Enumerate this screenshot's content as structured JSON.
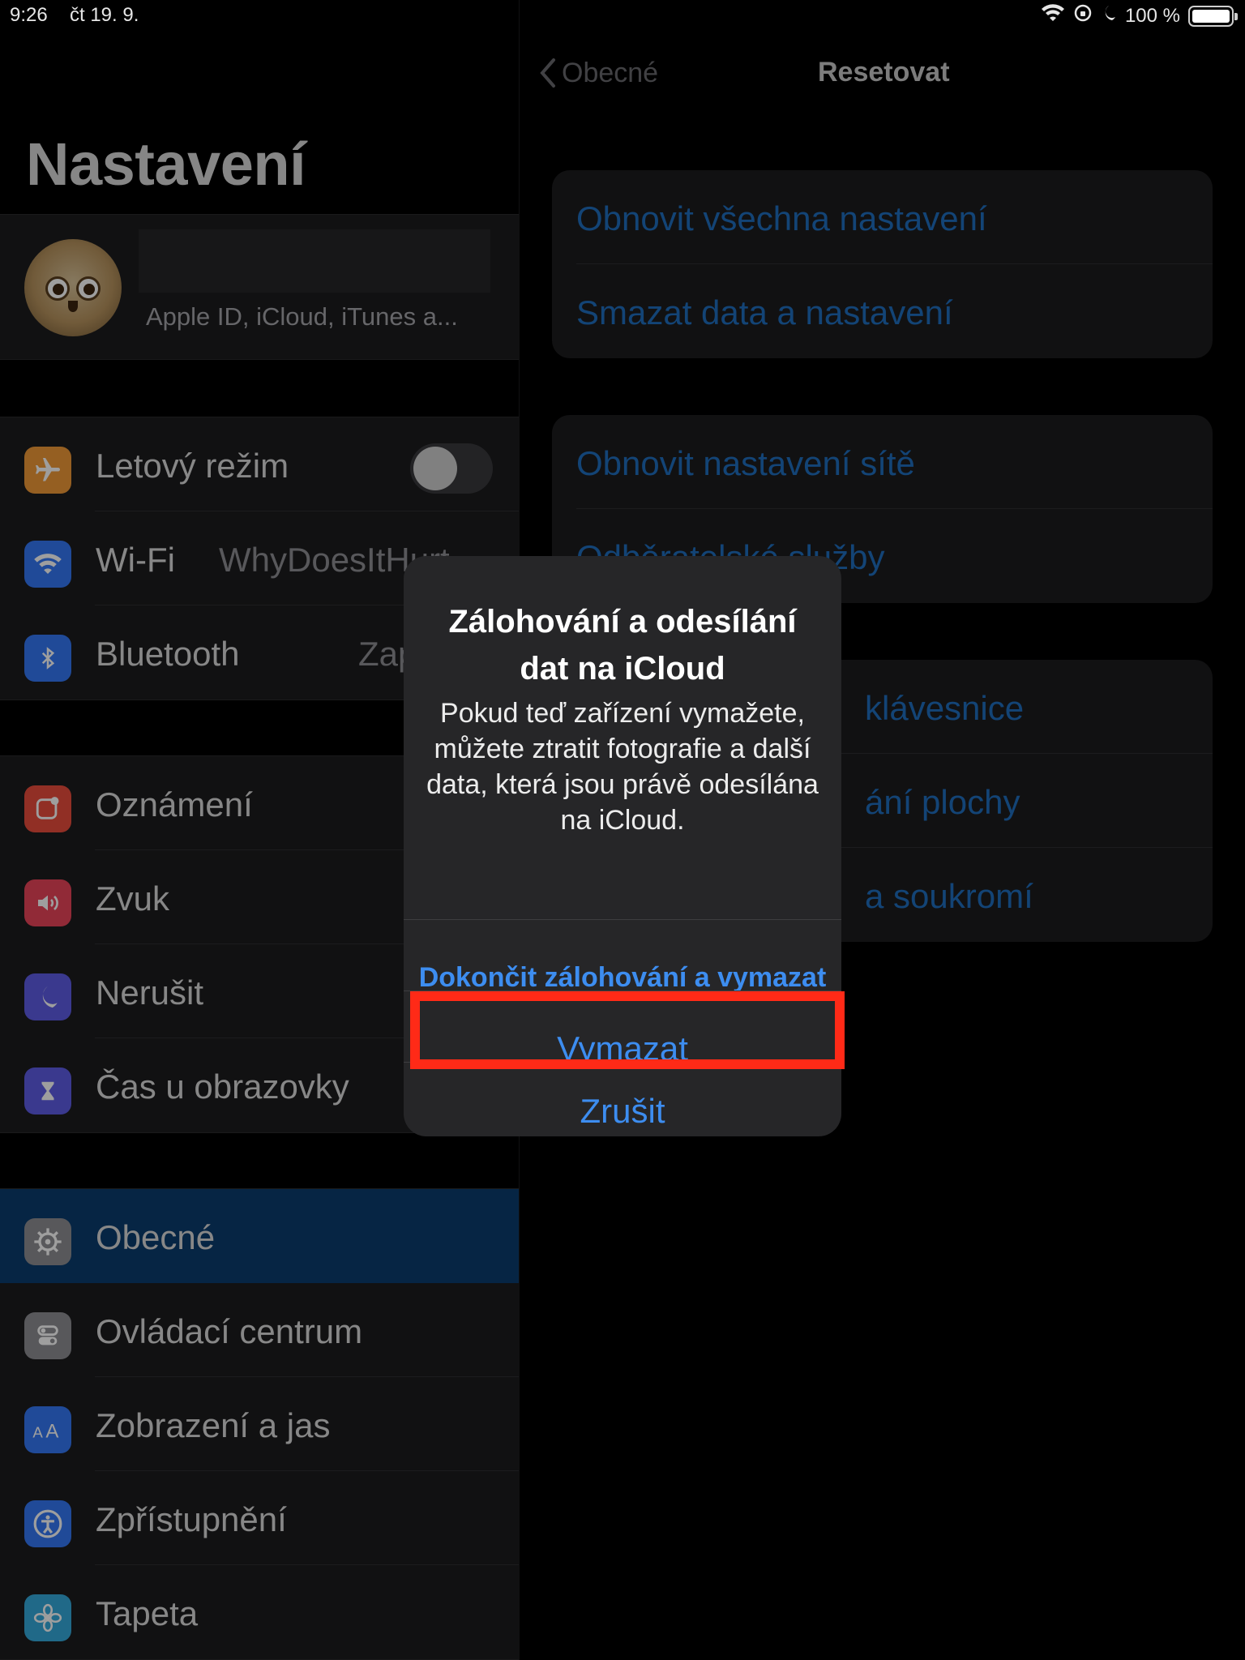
{
  "status_bar": {
    "time": "9:26",
    "date": "čt 19. 9.",
    "battery_text": "100 %"
  },
  "sidebar": {
    "title": "Nastavení",
    "profile": {
      "subtitle": "Apple ID, iCloud, iTunes a..."
    },
    "groups": [
      {
        "items": [
          {
            "label": "Letový režim",
            "icon": "airplane-icon",
            "color": "#f09a37",
            "control": "toggle-off"
          },
          {
            "label": "Wi-Fi",
            "icon": "wifi-icon",
            "color": "#3478f6",
            "value": "WhyDoesItHurt"
          },
          {
            "label": "Bluetooth",
            "icon": "bluetooth-icon",
            "color": "#3478f6",
            "value": "Zap"
          }
        ]
      },
      {
        "items": [
          {
            "label": "Oznámení",
            "icon": "notifications-icon",
            "color": "#eb4d3d"
          },
          {
            "label": "Zvuk",
            "icon": "sound-icon",
            "color": "#eb445a"
          },
          {
            "label": "Nerušit",
            "icon": "moon-icon",
            "color": "#5e5ce6"
          },
          {
            "label": "Čas u obrazovky",
            "icon": "hourglass-icon",
            "color": "#5e5ce6"
          }
        ]
      },
      {
        "items": [
          {
            "label": "Obecné",
            "icon": "gear-icon",
            "color": "#8e8e93",
            "selected": true
          },
          {
            "label": "Ovládací centrum",
            "icon": "switches-icon",
            "color": "#8e8e93"
          },
          {
            "label": "Zobrazení a jas",
            "icon": "text-size-icon",
            "color": "#3478f6"
          },
          {
            "label": "Zpřístupnění",
            "icon": "accessibility-icon",
            "color": "#3478f6"
          },
          {
            "label": "Tapeta",
            "icon": "flower-icon",
            "color": "#35aadc"
          }
        ]
      }
    ]
  },
  "detail": {
    "back_label": "Obecné",
    "title": "Resetovat",
    "groups": [
      {
        "items": [
          "Obnovit všechna nastavení",
          "Smazat data a nastavení"
        ]
      },
      {
        "items": [
          "Obnovit nastavení sítě",
          "Odběratelské služby"
        ]
      },
      {
        "items": [
          "klávesnice",
          "ání plochy",
          "a soukromí"
        ]
      }
    ]
  },
  "alert": {
    "title": "Zálohování a odesílání dat na iCloud",
    "message": "Pokud teď zařízení vymažete, můžete ztratit fotografie a další data, která jsou právě odesílána na iCloud.",
    "buttons": {
      "finish": "Dokončit zálohování a vymazat",
      "erase": "Vymazat",
      "cancel": "Zrušit"
    }
  },
  "colors": {
    "accent": "#3d8df0",
    "highlight_box": "#ff2a17",
    "selected_row": "#0a3c6e"
  }
}
